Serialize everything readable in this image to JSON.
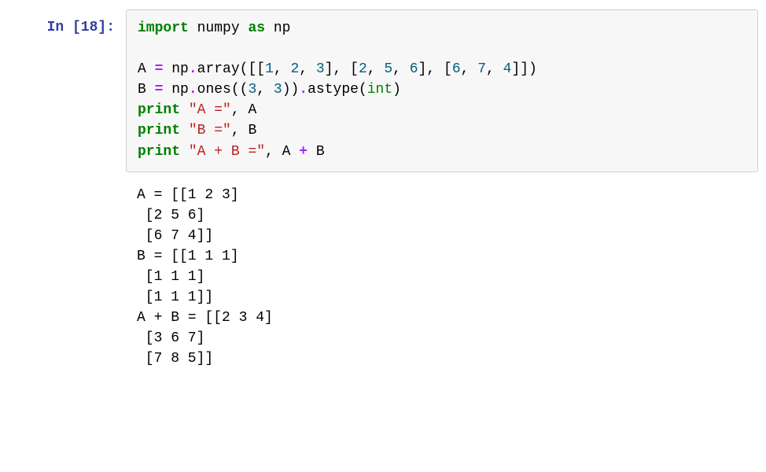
{
  "prompt": {
    "label": "In [18]:"
  },
  "code": {
    "line1": {
      "kw_import": "import",
      "module": " numpy ",
      "kw_as": "as",
      "alias": " np"
    },
    "line2": "",
    "line3": {
      "seg1": "A ",
      "op1": "=",
      "seg2": " np",
      "op2": ".",
      "seg3": "array([[",
      "n1": "1",
      "c1": ", ",
      "n2": "2",
      "c2": ", ",
      "n3": "3",
      "c3": "], [",
      "n4": "2",
      "c4": ", ",
      "n5": "5",
      "c5": ", ",
      "n6": "6",
      "c6": "], [",
      "n7": "6",
      "c7": ", ",
      "n8": "7",
      "c8": ", ",
      "n9": "4",
      "c9": "]])"
    },
    "line4": {
      "seg1": "B ",
      "op1": "=",
      "seg2": " np",
      "op2": ".",
      "seg3": "ones((",
      "n1": "3",
      "c1": ", ",
      "n2": "3",
      "c2": "))",
      "op3": ".",
      "seg4": "astype(",
      "bi": "int",
      "c3": ")"
    },
    "line5": {
      "kw": "print",
      "sp": " ",
      "str": "\"A =\"",
      "c1": ", A"
    },
    "line6": {
      "kw": "print",
      "sp": " ",
      "str": "\"B =\"",
      "c1": ", B"
    },
    "line7": {
      "kw": "print",
      "sp": " ",
      "str": "\"A + B =\"",
      "c1": ", A ",
      "op": "+",
      "c2": " B"
    }
  },
  "output": {
    "text": "A = [[1 2 3]\n [2 5 6]\n [6 7 4]]\nB = [[1 1 1]\n [1 1 1]\n [1 1 1]]\nA + B = [[2 3 4]\n [3 6 7]\n [7 8 5]]"
  }
}
